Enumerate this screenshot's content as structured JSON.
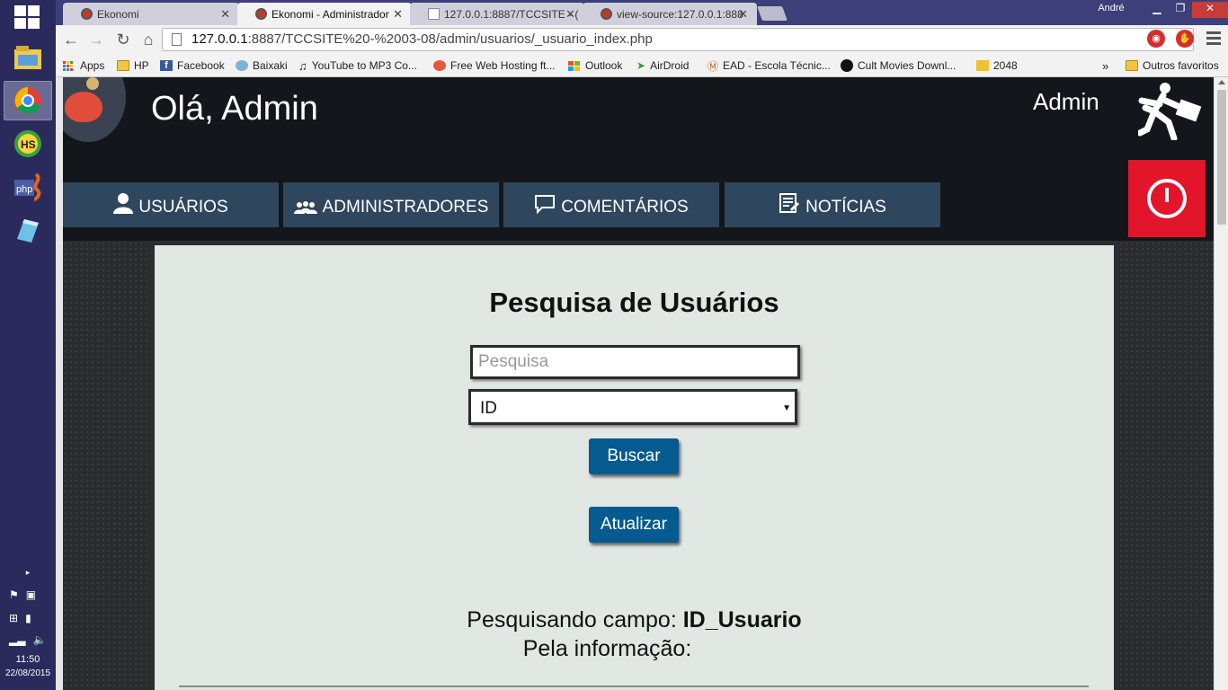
{
  "taskbar": {
    "apps": [
      "file-explorer",
      "chrome",
      "hs-app",
      "php-app",
      "notes-app"
    ],
    "clock": "11:50",
    "date": "22/08/2015"
  },
  "browser": {
    "user": "André",
    "tabs": [
      {
        "title": "Ekonomi",
        "active": false
      },
      {
        "title": "Ekonomi - Administrador",
        "active": true
      },
      {
        "title": "127.0.0.1:8887/TCCSITE - (",
        "active": false
      },
      {
        "title": "view-source:127.0.0.1:888",
        "active": false
      }
    ],
    "url_host": "127.0.0.1",
    "url_rest": ":8887/TCCSITE%20-%2003-08/admin/usuarios/_usuario_index.php",
    "bookmarks": [
      "Apps",
      "HP",
      "Facebook",
      "Baixaki",
      "YouTube to MP3 Co...",
      "Free Web Hosting ft...",
      "Outlook",
      "AirDroid",
      "EAD - Escola Técnic...",
      "Cult Movies Downl...",
      "2048"
    ],
    "more_bookmarks": "»",
    "other_bookmarks": "Outros favoritos"
  },
  "header": {
    "greeting": "Olá, Admin",
    "admin_name": "Admin"
  },
  "nav": {
    "items": [
      "USUÁRIOS",
      "ADMINISTRADORES",
      "COMENTÁRIOS",
      "NOTÍCIAS"
    ]
  },
  "search": {
    "title": "Pesquisa de Usuários",
    "placeholder": "Pesquisa",
    "field_selected": "ID",
    "search_button": "Buscar",
    "refresh_button": "Atualizar",
    "status_prefix": "Pesquisando campo: ",
    "status_field": "ID_Usuario",
    "info_label": "Pela informação:"
  },
  "colors": {
    "nav_bg": "#2f475e",
    "header_bg": "#13161b",
    "logout_red": "#e2152a",
    "button_blue": "#055a8f",
    "content_bg": "#e1e8e3"
  }
}
